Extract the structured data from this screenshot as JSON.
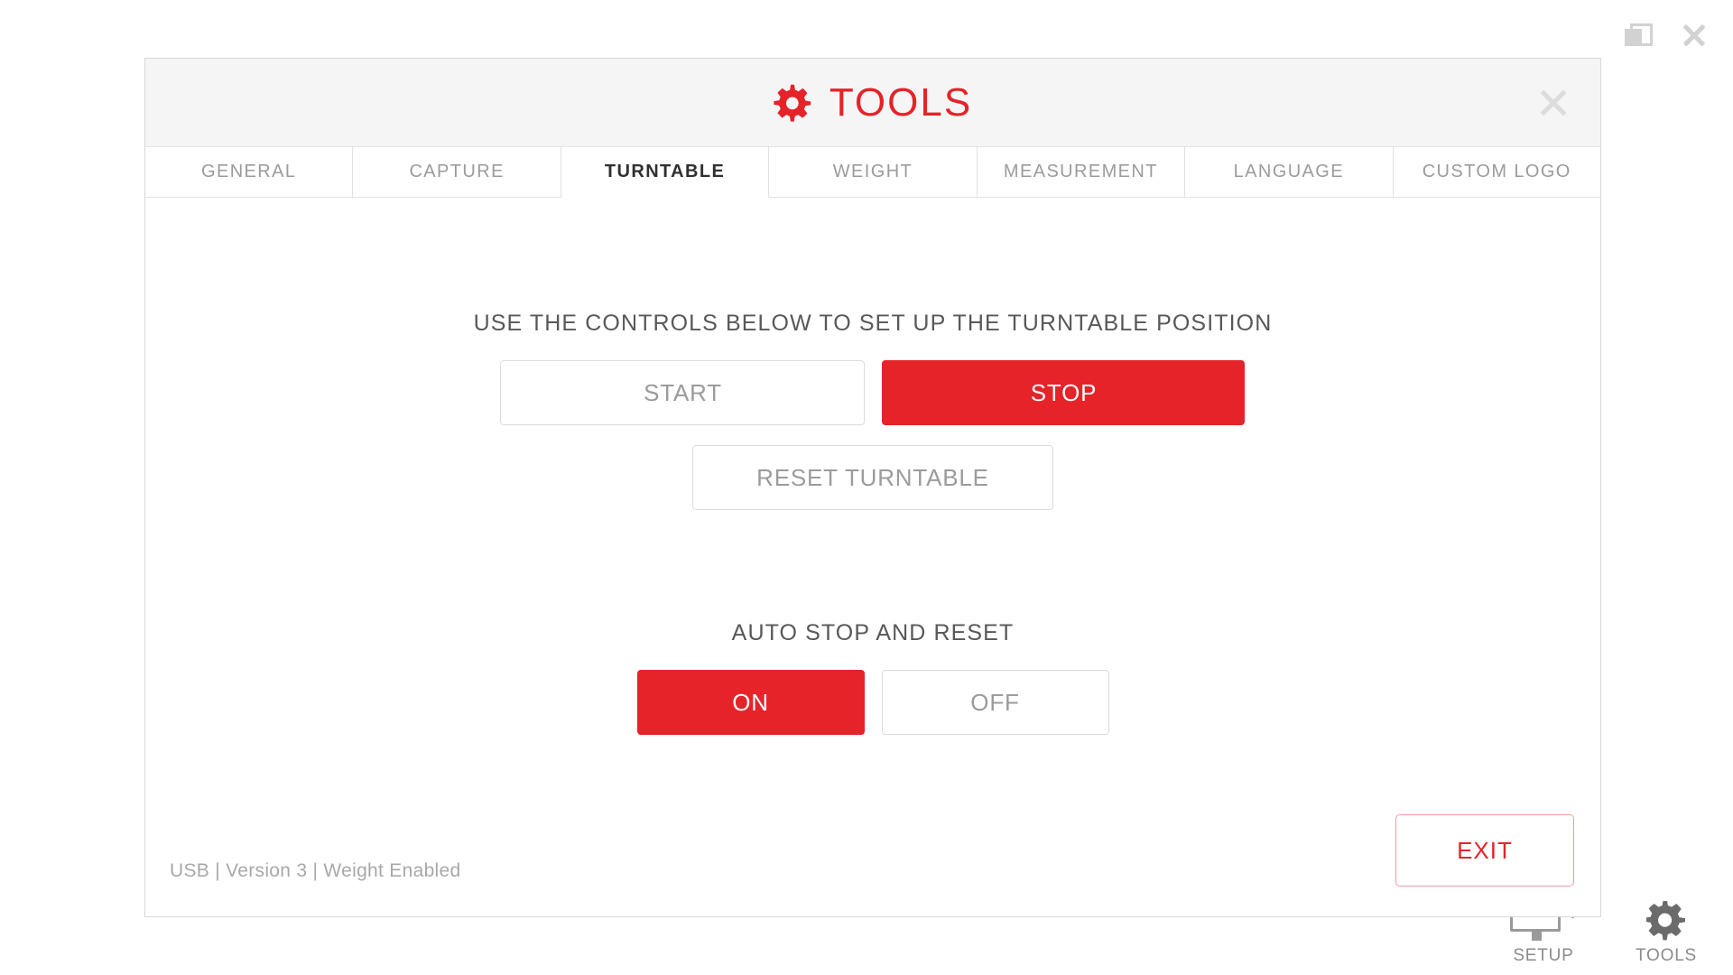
{
  "window": {
    "controls": [
      {
        "name": "restore-window-button",
        "icon": "restore-icon"
      },
      {
        "name": "close-window-button",
        "icon": "close-icon"
      }
    ]
  },
  "bottom_nav": {
    "items": [
      {
        "label": "SETUP",
        "icon": "scanner-icon"
      },
      {
        "label": "TOOLS",
        "icon": "gear-icon"
      }
    ]
  },
  "dialog": {
    "title": "TOOLS",
    "title_icon": "gear-icon",
    "close_icon": "close-icon",
    "accent_color": "#e52329",
    "header_bg": "#f5f5f5",
    "tabs": [
      {
        "label": "GENERAL",
        "active": false
      },
      {
        "label": "CAPTURE",
        "active": false
      },
      {
        "label": "TURNTABLE",
        "active": true
      },
      {
        "label": "WEIGHT",
        "active": false
      },
      {
        "label": "MEASUREMENT",
        "active": false
      },
      {
        "label": "LANGUAGE",
        "active": false
      },
      {
        "label": "CUSTOM LOGO",
        "active": false
      }
    ],
    "turntable": {
      "instruction": "USE THE CONTROLS BELOW TO SET UP THE TURNTABLE POSITION",
      "start_label": "START",
      "start_state": "inactive",
      "stop_label": "STOP",
      "stop_state": "active",
      "reset_label": "RESET TURNTABLE",
      "reset_state": "inactive"
    },
    "auto_stop": {
      "label": "AUTO STOP AND RESET",
      "on_label": "ON",
      "off_label": "OFF",
      "selected": "ON"
    },
    "footer": {
      "status": "USB | Version 3 | Weight Enabled",
      "exit_label": "EXIT"
    }
  }
}
